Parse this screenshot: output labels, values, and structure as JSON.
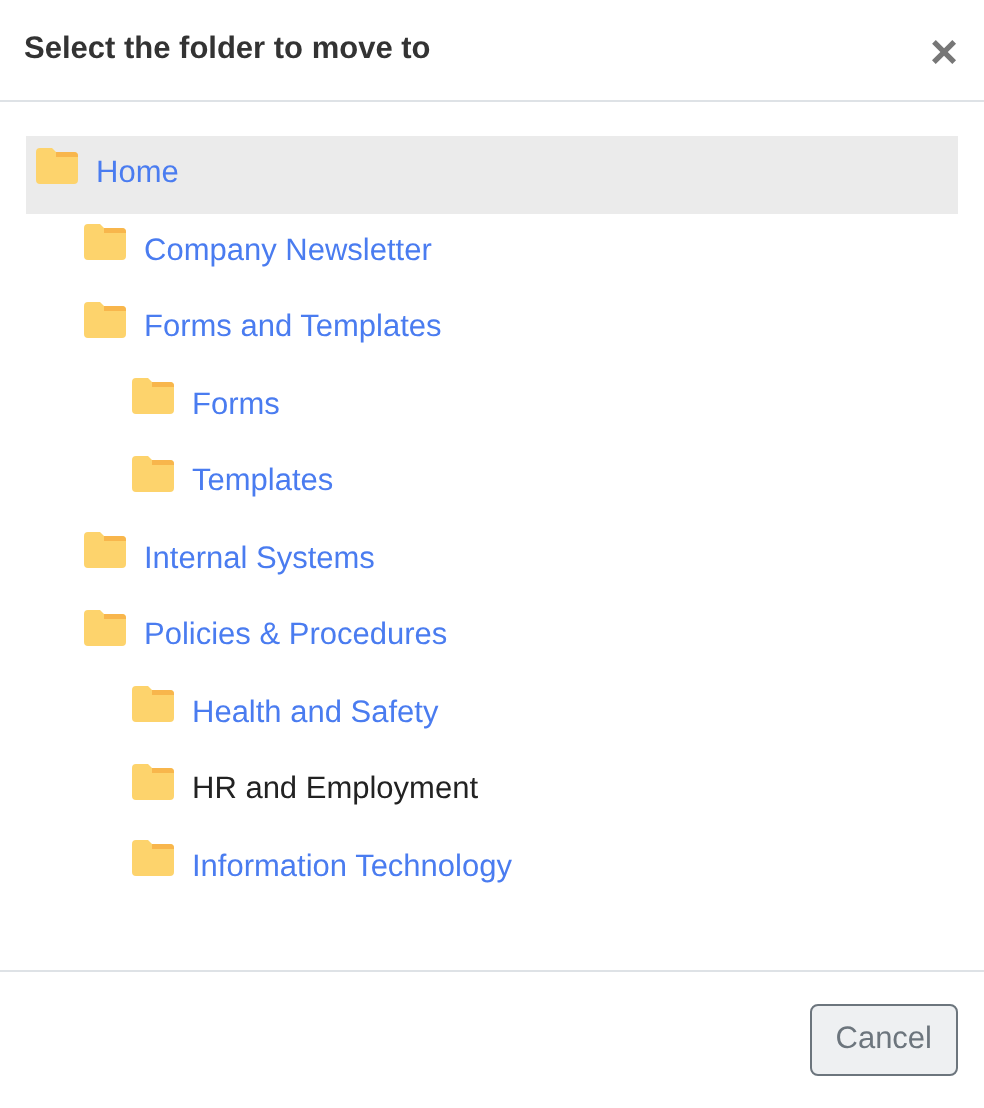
{
  "dialog": {
    "title": "Select the folder to move to",
    "close": "×"
  },
  "tree": [
    {
      "label": "Home",
      "selected": true,
      "disabled": false,
      "children": [
        {
          "label": "Company Newsletter",
          "selected": false,
          "disabled": false
        },
        {
          "label": "Forms and Templates",
          "selected": false,
          "disabled": false,
          "children": [
            {
              "label": "Forms",
              "selected": false,
              "disabled": false
            },
            {
              "label": "Templates",
              "selected": false,
              "disabled": false
            }
          ]
        },
        {
          "label": "Internal Systems",
          "selected": false,
          "disabled": false
        },
        {
          "label": "Policies & Procedures",
          "selected": false,
          "disabled": false,
          "children": [
            {
              "label": "Health and Safety",
              "selected": false,
              "disabled": false
            },
            {
              "label": "HR and Employment",
              "selected": false,
              "disabled": true
            },
            {
              "label": "Information Technology",
              "selected": false,
              "disabled": false
            }
          ]
        }
      ]
    }
  ],
  "buttons": [
    "Cancel"
  ]
}
